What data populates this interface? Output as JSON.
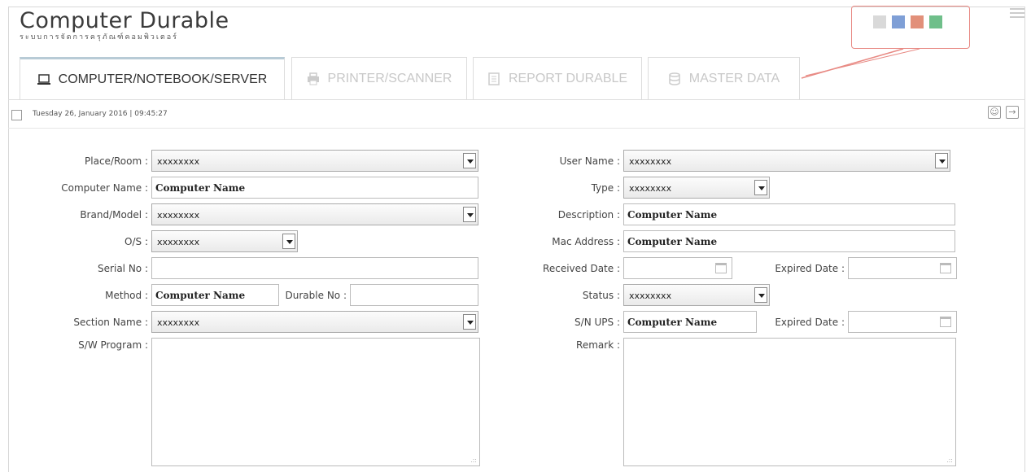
{
  "app": {
    "title": "Computer Durable",
    "subtitle": "ระบบการจัดการครุภัณฑ์คอมพิวเตอร์"
  },
  "theme": {
    "swatches": [
      "#d9d9d9",
      "#7f9fd6",
      "#e2907a",
      "#6fbf8a"
    ],
    "accent": "#e88a84"
  },
  "tabs": [
    {
      "label": "COMPUTER/NOTEBOOK/SERVER",
      "icon": "laptop-icon",
      "active": true
    },
    {
      "label": "PRINTER/SCANNER",
      "icon": "printer-icon",
      "active": false
    },
    {
      "label": "REPORT DURABLE",
      "icon": "report-icon",
      "active": false
    },
    {
      "label": "MASTER DATA",
      "icon": "database-icon",
      "active": false
    }
  ],
  "infobar": {
    "date": "Tuesday 26, January 2016 | 09:45:27"
  },
  "form_left": {
    "place_room": {
      "label": "Place/Room :",
      "value": "xxxxxxxx"
    },
    "computer_name": {
      "label": "Computer Name :",
      "value": "Computer Name"
    },
    "brand_model": {
      "label": "Brand/Model :",
      "value": "xxxxxxxx"
    },
    "os": {
      "label": "O/S :",
      "value": "xxxxxxxx"
    },
    "serial_no": {
      "label": "Serial No :",
      "value": ""
    },
    "method": {
      "label": "Method :",
      "value": "Computer Name"
    },
    "durable_no": {
      "label": "Durable No :",
      "value": ""
    },
    "section_name": {
      "label": "Section Name :",
      "value": "xxxxxxxx"
    },
    "sw_program": {
      "label": "S/W Program :",
      "value": ""
    }
  },
  "form_right": {
    "user_name": {
      "label": "User Name :",
      "value": "xxxxxxxx"
    },
    "type": {
      "label": "Type :",
      "value": "xxxxxxxx"
    },
    "description": {
      "label": "Description :",
      "value": "Computer Name"
    },
    "mac_address": {
      "label": "Mac Address :",
      "value": "Computer Name"
    },
    "received_date": {
      "label": "Received Date :",
      "value": ""
    },
    "expired_date_1": {
      "label": "Expired Date :",
      "value": ""
    },
    "status": {
      "label": "Status :",
      "value": "xxxxxxxx"
    },
    "sn_ups": {
      "label": "S/N UPS :",
      "value": "Computer Name"
    },
    "expired_date_2": {
      "label": "Expired Date :",
      "value": ""
    },
    "remark": {
      "label": "Remark :",
      "value": ""
    }
  }
}
